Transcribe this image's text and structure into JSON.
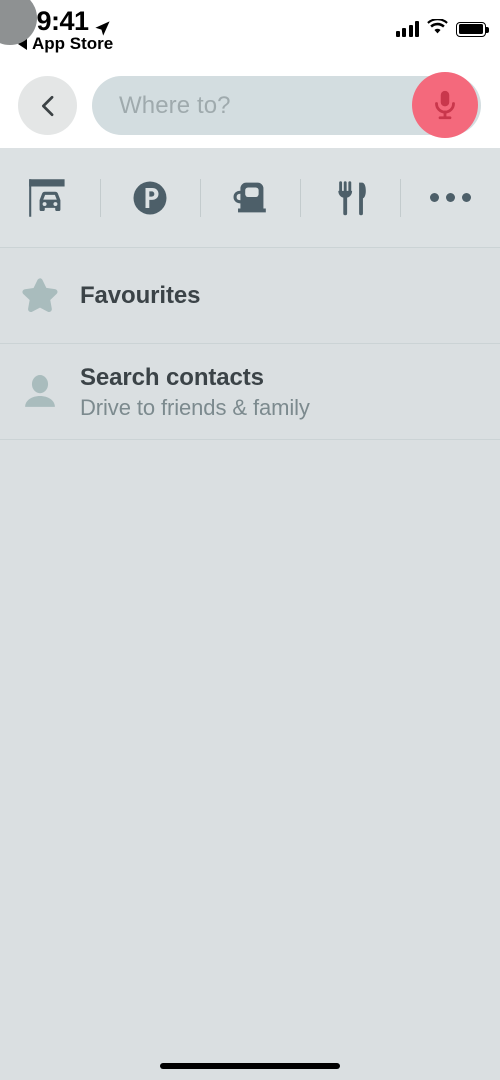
{
  "status_bar": {
    "time": "09:41",
    "location_arrow_icon": "location-arrow-icon",
    "back_to_app_label": "App Store",
    "back_triangle_icon": "triangle-left-icon",
    "signal_icon": "cellular-signal-icon",
    "signal_bars_filled": 4,
    "wifi_icon": "wifi-icon",
    "battery_icon": "battery-full-icon"
  },
  "header": {
    "back_button_icon": "chevron-left-icon",
    "search": {
      "placeholder": "Where to?",
      "value": "",
      "mic_icon": "microphone-icon"
    }
  },
  "categories": [
    {
      "id": "car-wash",
      "icon": "car-under-canopy-icon",
      "label": "Car wash"
    },
    {
      "id": "parking",
      "icon": "parking-p-icon",
      "label": "Parking"
    },
    {
      "id": "fuel",
      "icon": "fuel-pump-icon",
      "label": "Fuel"
    },
    {
      "id": "restaurant",
      "icon": "fork-knife-icon",
      "label": "Restaurants"
    },
    {
      "id": "more",
      "icon": "more-dots-icon",
      "label": "More"
    }
  ],
  "list": {
    "favourites": {
      "icon": "star-icon",
      "title": "Favourites"
    },
    "contacts": {
      "icon": "person-icon",
      "title": "Search contacts",
      "subtitle": "Drive to friends & family"
    }
  },
  "system": {
    "home_indicator": "home-indicator",
    "touch_indicator": "touch-point-indicator"
  },
  "colors": {
    "background": "#dadfe1",
    "header_bg": "#ffffff",
    "search_field": "#d3dde0",
    "mic_accent": "#f4697c",
    "icon_slate": "#4d5f69",
    "muted_sage": "#a9bcbd",
    "title_text": "#3b4347",
    "sub_text": "#7c8a8e",
    "divider": "#cbd3d5"
  }
}
